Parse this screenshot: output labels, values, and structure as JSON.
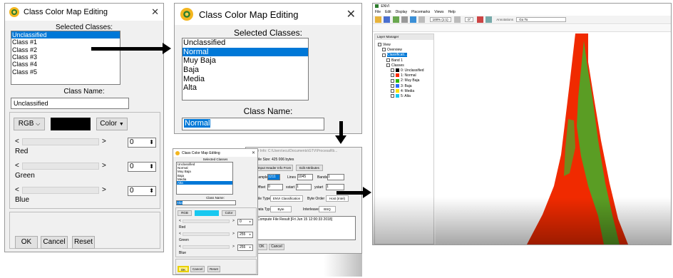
{
  "dialog_small": {
    "title": "Class Color Map Editing",
    "close_glyph": "✕",
    "selected_classes_label": "Selected Classes:",
    "classes": [
      "Unclassified",
      "Class #1",
      "Class #2",
      "Class #3",
      "Class #4",
      "Class #5"
    ],
    "class_name_label": "Class Name:",
    "class_name_value": "Unclassified",
    "color_model": "RGB",
    "color_menu": "Color",
    "swatch_color": "#000000",
    "channels": [
      {
        "name": "Red",
        "value": "0"
      },
      {
        "name": "Green",
        "value": "0"
      },
      {
        "name": "Blue",
        "value": "0"
      }
    ],
    "ok": "OK",
    "cancel": "Cancel",
    "reset": "Reset"
  },
  "dialog_zoom": {
    "title": "Class Color Map Editing",
    "close_glyph": "✕",
    "selected_classes_label": "Selected Classes:",
    "classes": [
      "Unclassified",
      "Normal",
      "Muy Baja",
      "Baja",
      "Media",
      "Alta"
    ],
    "selected_index": 1,
    "class_name_label": "Class Name:",
    "class_name_value": "Normal"
  },
  "composite": {
    "header_info_title": "Header Info: C:\\Users\\ecu\\Documents\\GTV\\ProcesaRb...",
    "file_size": "File Size: 425 006 bytes",
    "input_header_info": "Input Header Info From",
    "edit_attributes": "Edit Attributes",
    "samples_label": "Samples",
    "samples_value": "1211",
    "lines_label": "Lines",
    "lines_value": "1045",
    "bands_label": "Bands",
    "bands_value": "1",
    "offset_label": "Offset",
    "offset_value": "0",
    "xstart_label": "xstart",
    "xstart_value": "1",
    "ystart_label": "ystart",
    "ystart_value": "1",
    "file_type_label": "File Type",
    "file_type_value": "ENVI Classification",
    "byte_order_label": "Byte Order",
    "byte_order_value": "Host (Intel)",
    "data_type_label": "Data Type",
    "data_type_value": "Byte",
    "interleave_label": "Interleave",
    "interleave_value": "BSQ",
    "description": "Compute File Result [Fri Jun 15 12:00:33 2018]",
    "ok": "OK",
    "cancel": "Cancel",
    "mini_dialog": {
      "title": "Class Color Map Editing",
      "selected_classes_label": "Selected Classes",
      "classes": [
        "Unclassified",
        "Normal",
        "Muy Baja",
        "Baja",
        "Media",
        "Alta"
      ],
      "selected_index": 5,
      "class_name_label": "Class Name:",
      "class_name_value": "Alta",
      "color_model": "RGB",
      "color_menu": "Color",
      "swatch_color": "#18c8f0",
      "channels": [
        {
          "name": "Red",
          "value": "0"
        },
        {
          "name": "Green",
          "value": "255"
        },
        {
          "name": "Blue",
          "value": "255"
        }
      ],
      "ok": "OK",
      "cancel": "Cancel",
      "reset": "Reset"
    }
  },
  "envi": {
    "app_title": "ENVI",
    "menu": [
      "File",
      "Edit",
      "Display",
      "Placemarks",
      "Views",
      "Help"
    ],
    "zoom_value": "100% (1:1)",
    "rotate_value": "0°",
    "annotations_label": "Annotations",
    "goto_label": "Go To",
    "layer_manager_title": "Layer Manager",
    "layers": [
      {
        "label": "View",
        "indent": 0
      },
      {
        "label": "Overview",
        "indent": 1
      },
      {
        "label": "Classificati...",
        "indent": 1,
        "highlight": true
      },
      {
        "label": "Band 1",
        "indent": 2
      },
      {
        "label": "Classes",
        "indent": 2
      },
      {
        "label": "0: Unclassified",
        "indent": 3,
        "color": "#000000"
      },
      {
        "label": "1: Normal",
        "indent": 3,
        "color": "#ff2a00"
      },
      {
        "label": "2: Muy Baja",
        "indent": 3,
        "color": "#2db800"
      },
      {
        "label": "3: Baja",
        "indent": 3,
        "color": "#2a6cff"
      },
      {
        "label": "4: Media",
        "indent": 3,
        "color": "#ffe100"
      },
      {
        "label": "5: Alta",
        "indent": 3,
        "color": "#18c8f0"
      }
    ],
    "map_colors": {
      "red": "#f02a00",
      "green": "#3fb22a"
    }
  },
  "arrows_color": "#000000"
}
